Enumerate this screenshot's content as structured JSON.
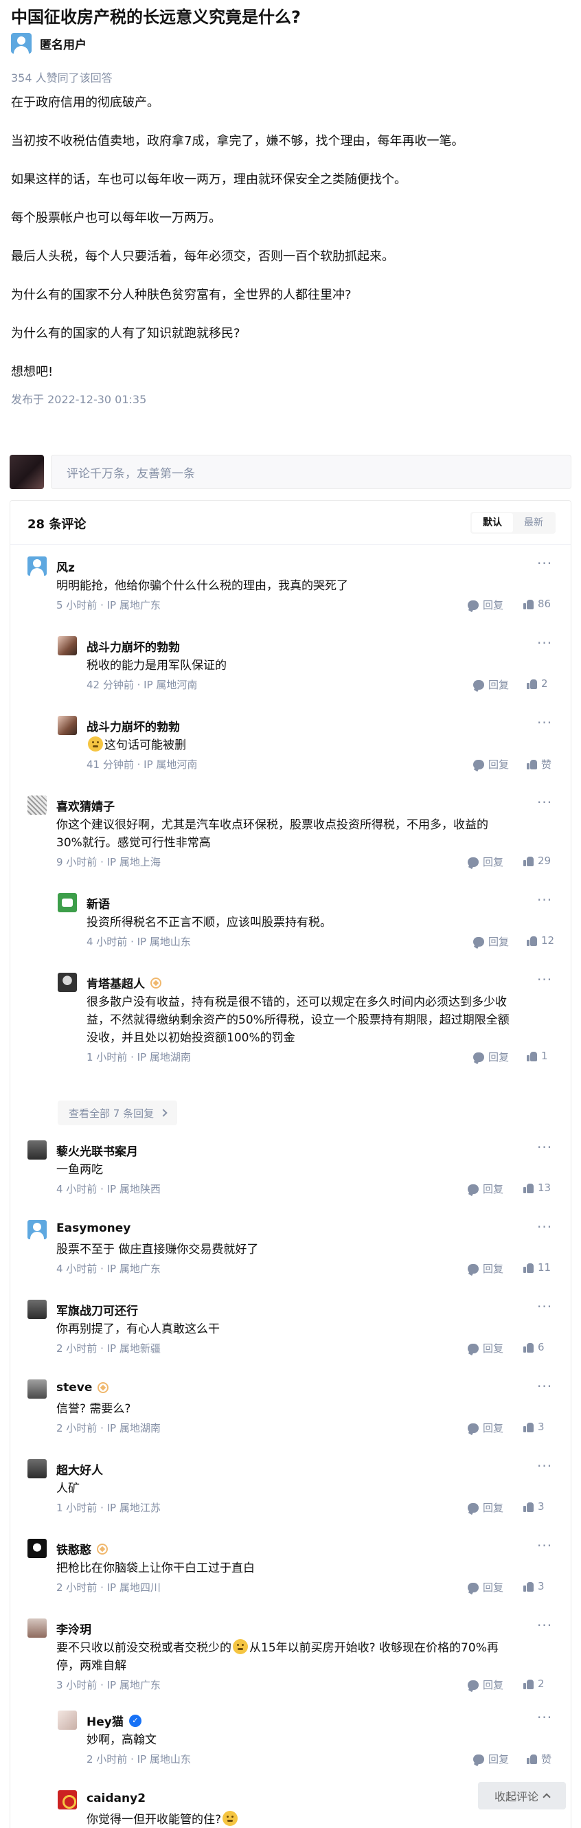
{
  "question": {
    "title": "中国征收房产税的长远意义究竟是什么?"
  },
  "author": {
    "name": "匿名用户"
  },
  "answer": {
    "vote_summary": "354 人赞同了该回答",
    "paragraphs": [
      "在于政府信用的彻底破产。",
      "当初按不收税估值卖地，政府拿7成，拿完了，嫌不够，找个理由，每年再收一笔。",
      "如果这样的话，车也可以每年收一两万，理由就环保安全之类随便找个。",
      "每个股票帐户也可以每年收一万两万。",
      "最后人头税，每个人只要活着，每年必须交，否则一百个软肋抓起来。",
      "为什么有的国家不分人种肤色贫穷富有，全世界的人都往里冲?",
      "为什么有的国家的人有了知识就跑就移民?",
      "想想吧!"
    ],
    "publish_time": "发布于 2022-12-30 01:35"
  },
  "composer": {
    "placeholder": "评论千万条，友善第一条"
  },
  "comments_header": {
    "count": "28 条评论",
    "sort_default": "默认",
    "sort_latest": "最新"
  },
  "comments": [
    {
      "name": "风z",
      "text": "明明能抢，他给你骗个什么什么税的理由，我真的哭死了",
      "meta": "5 小时前 · IP 属地广东",
      "likes": "86"
    },
    {
      "name": "战斗力崩坏的勃勃",
      "text": "税收的能力是用军队保证的",
      "meta": "42 分钟前 · IP 属地河南",
      "likes": "2"
    },
    {
      "name": "战斗力崩坏的勃勃",
      "text": "这句话可能被删",
      "meta": "41 分钟前 · IP 属地河南",
      "likes": "赞"
    },
    {
      "name": "喜欢猜婧子",
      "text_lines": [
        "你这个建议很好啊，尤其是汽车收点环保税，股票收点投资所得税，不用多，收益的",
        "30%就行。感觉可行性非常高"
      ],
      "meta": "9 小时前 · IP 属地上海",
      "likes": "29"
    },
    {
      "name": "新语",
      "text": "投资所得税名不正言不顺，应该叫股票持有税。",
      "meta": "4 小时前 · IP 属地山东",
      "likes": "12"
    },
    {
      "name": "肯塔基超人",
      "text_lines": [
        "很多散户没有收益，持有税是很不错的，还可以规定在多久时间内必须达到多少收",
        "益，不然就得缴纳剩余资产的50%所得税，设立一个股票持有期限，超过期限全额",
        "没收，并且处以初始投资额100%的罚金"
      ],
      "meta": "1 小时前 · IP 属地湖南",
      "likes": "1"
    },
    {
      "name": "藜火光联书案月",
      "text": "一鱼两吃",
      "meta": "4 小时前 · IP 属地陕西",
      "likes": "13"
    },
    {
      "name": "Easymoney",
      "text": "股票不至于 做庄直接赚你交易费就好了",
      "meta": "4 小时前 · IP 属地广东",
      "likes": "11"
    },
    {
      "name": "军旗战刀可还行",
      "text": "你再别提了，有心人真敢这么干",
      "meta": "2 小时前 · IP 属地新疆",
      "likes": "6"
    },
    {
      "name": "steve",
      "text": "信誉? 需要么?",
      "meta": "2 小时前 · IP 属地湖南",
      "likes": "3"
    },
    {
      "name": "超大好人",
      "text": "人矿",
      "meta": "1 小时前 · IP 属地江苏",
      "likes": "3"
    },
    {
      "name": "铁憨憨",
      "text": "把枪比在你脑袋上让你干白工过于直白",
      "meta": "2 小时前 · IP 属地四川",
      "likes": "3"
    },
    {
      "name": "李泠玥",
      "text_lines": [
        "要不只收以前没交税或者交税少的",
        "从15年以前买房开始收? 收够现在价格的70%再",
        "停，两难自解"
      ],
      "meta": "3 小时前 · IP 属地广东",
      "likes": "2"
    },
    {
      "name": "Hey猫",
      "text": "妙啊，高翰文",
      "meta": "2 小时前 · IP 属地山东",
      "likes": "赞"
    },
    {
      "name": "caidany2",
      "text": "你觉得一但开收能管的住?"
    }
  ],
  "labels": {
    "reply": "回复",
    "view_all": "查看全部 7 条回复",
    "collapse": "收起评论"
  },
  "colors": {
    "meta_gray": "#8590a6",
    "accent_blue": "#1772f6",
    "badge_gold": "#f0b86e"
  }
}
